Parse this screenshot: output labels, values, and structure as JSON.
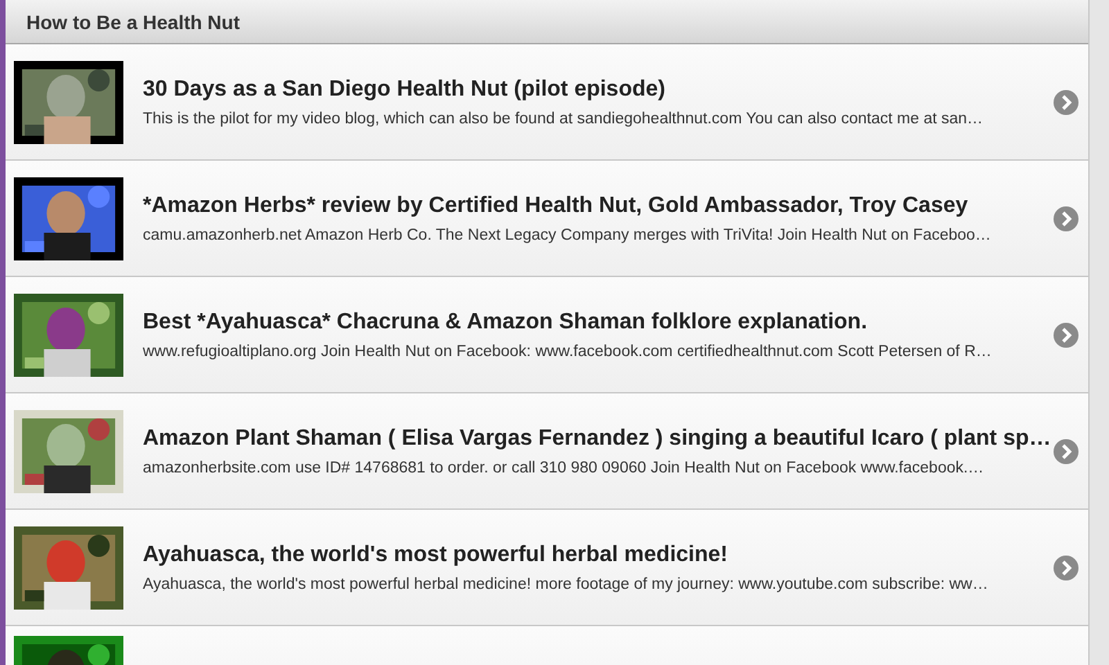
{
  "header": {
    "title": "How to Be a Health Nut"
  },
  "videos": [
    {
      "title": "30 Days as a San Diego Health Nut (pilot episode)",
      "description": "This is the pilot for my video blog, which can also be found at sandiegohealthnut.com You can also contact me at san…"
    },
    {
      "title": "*Amazon Herbs* review by Certified Health Nut, Gold Ambassador, Troy Casey",
      "description": "camu.amazonherb.net Amazon Herb Co. The Next Legacy Company merges with TriVita! Join Health Nut on Faceboo…"
    },
    {
      "title": "Best *Ayahuasca* Chacruna & Amazon Shaman folklore explanation.",
      "description": "www.refugioaltiplano.org Join Health Nut on Facebook: www.facebook.com certifiedhealthnut.com Scott Petersen of R…"
    },
    {
      "title": "Amazon Plant Shaman ( Elisa Vargas Fernandez ) singing a beautiful Icaro ( plant sp…",
      "description": "amazonherbsite.com use ID# 14768681 to order. or call 310 980 09060 Join Health Nut on Facebook www.facebook.…"
    },
    {
      "title": "Ayahuasca, the world's most powerful herbal medicine!",
      "description": "Ayahuasca, the world's most powerful herbal medicine! more footage of my journey: www.youtube.com subscribe: ww…"
    },
    {
      "kind": "picture"
    }
  ]
}
